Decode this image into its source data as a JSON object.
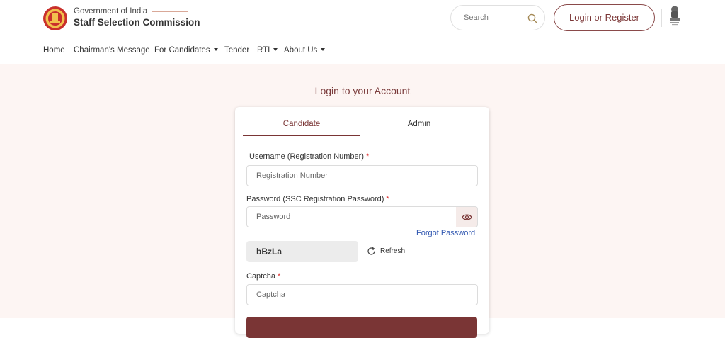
{
  "header": {
    "gov_text": "Government of India",
    "org_name": "Staff Selection Commission",
    "search_placeholder": "Search",
    "login_button": "Login or Register"
  },
  "nav": {
    "items": [
      {
        "label": "Home",
        "dropdown": false
      },
      {
        "label": "Chairman's Message",
        "dropdown": false
      },
      {
        "label": "For Candidates",
        "dropdown": true
      },
      {
        "label": "Tender",
        "dropdown": false
      },
      {
        "label": "RTI",
        "dropdown": true
      },
      {
        "label": "About Us",
        "dropdown": true
      }
    ]
  },
  "login": {
    "title": "Login to your Account",
    "tabs": [
      {
        "label": "Candidate",
        "active": true
      },
      {
        "label": "Admin",
        "active": false
      }
    ],
    "username_label": "Username (Registration Number)",
    "username_placeholder": "Registration Number",
    "password_label": "Password (SSC Registration Password)",
    "password_placeholder": "Password",
    "required_mark": "*",
    "forgot_password": "Forgot Password",
    "captcha_value": "bBzLa",
    "refresh_label": "Refresh",
    "captcha_label": "Captcha",
    "captcha_placeholder": "Captcha"
  },
  "colors": {
    "brand": "#7a3535",
    "link": "#2f56b0",
    "page_background": "#fdf5f3"
  },
  "icons": [
    "ssc-logo",
    "search-icon",
    "national-emblem",
    "eye-icon",
    "refresh-icon",
    "caret-down-icon"
  ]
}
